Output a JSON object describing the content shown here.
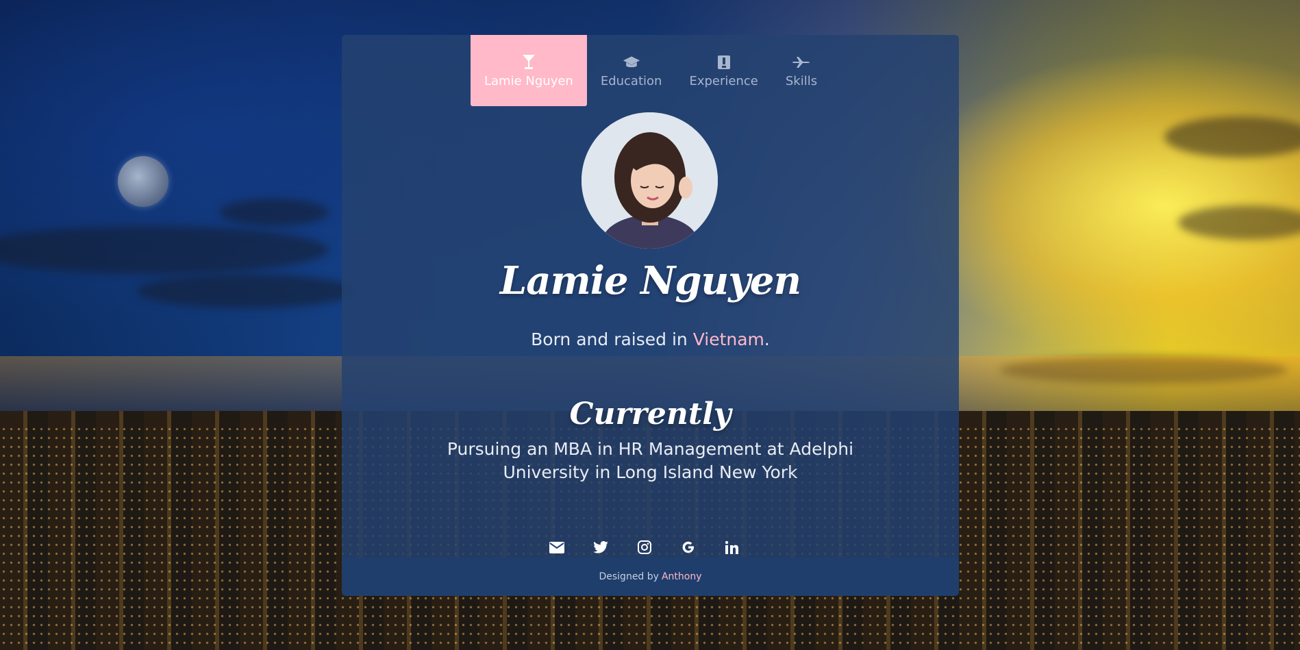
{
  "tabs": [
    {
      "label": "Lamie Nguyen",
      "icon": "cocktail-icon",
      "active": true
    },
    {
      "label": "Education",
      "icon": "graduation-cap-icon",
      "active": false
    },
    {
      "label": "Experience",
      "icon": "id-badge-icon",
      "active": false
    },
    {
      "label": "Skills",
      "icon": "plane-icon",
      "active": false
    }
  ],
  "profile": {
    "name": "Lamie Nguyen",
    "bio_prefix": "Born and raised in ",
    "bio_place": "Vietnam",
    "bio_suffix": "."
  },
  "currently": {
    "title": "Currently",
    "text": "Pursuing an MBA in HR Management at Adelphi University in Long Island New York"
  },
  "social": [
    {
      "icon": "envelope-icon"
    },
    {
      "icon": "twitter-icon"
    },
    {
      "icon": "instagram-icon"
    },
    {
      "icon": "google-icon"
    },
    {
      "icon": "linkedin-icon"
    }
  ],
  "footer": {
    "prefix": "Designed by",
    "author": "Anthony"
  },
  "colors": {
    "accent": "#ffb9c9",
    "card": "#254270",
    "footer": "#1f3e6c"
  }
}
